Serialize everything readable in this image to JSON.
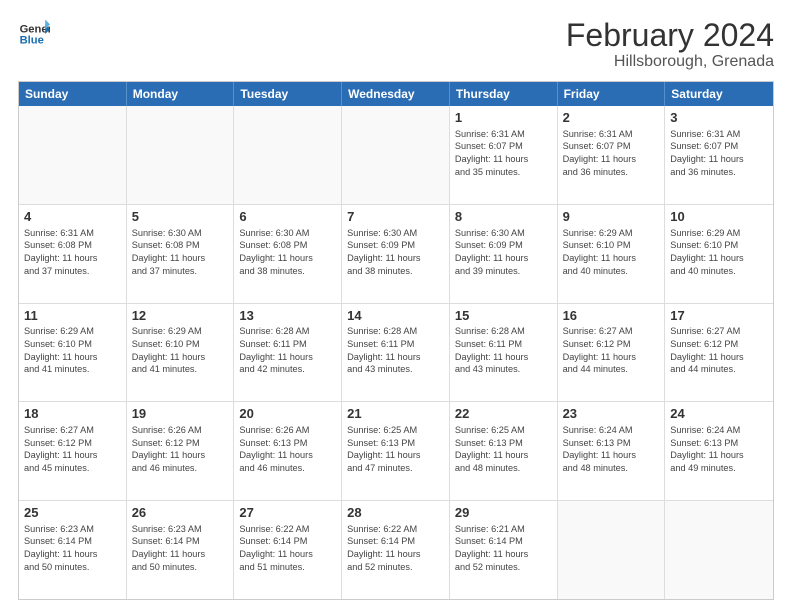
{
  "header": {
    "logo_line1": "General",
    "logo_line2": "Blue",
    "main_title": "February 2024",
    "sub_title": "Hillsborough, Grenada"
  },
  "days_of_week": [
    "Sunday",
    "Monday",
    "Tuesday",
    "Wednesday",
    "Thursday",
    "Friday",
    "Saturday"
  ],
  "weeks": [
    [
      {
        "day": "",
        "info": ""
      },
      {
        "day": "",
        "info": ""
      },
      {
        "day": "",
        "info": ""
      },
      {
        "day": "",
        "info": ""
      },
      {
        "day": "1",
        "info": "Sunrise: 6:31 AM\nSunset: 6:07 PM\nDaylight: 11 hours\nand 35 minutes."
      },
      {
        "day": "2",
        "info": "Sunrise: 6:31 AM\nSunset: 6:07 PM\nDaylight: 11 hours\nand 36 minutes."
      },
      {
        "day": "3",
        "info": "Sunrise: 6:31 AM\nSunset: 6:07 PM\nDaylight: 11 hours\nand 36 minutes."
      }
    ],
    [
      {
        "day": "4",
        "info": "Sunrise: 6:31 AM\nSunset: 6:08 PM\nDaylight: 11 hours\nand 37 minutes."
      },
      {
        "day": "5",
        "info": "Sunrise: 6:30 AM\nSunset: 6:08 PM\nDaylight: 11 hours\nand 37 minutes."
      },
      {
        "day": "6",
        "info": "Sunrise: 6:30 AM\nSunset: 6:08 PM\nDaylight: 11 hours\nand 38 minutes."
      },
      {
        "day": "7",
        "info": "Sunrise: 6:30 AM\nSunset: 6:09 PM\nDaylight: 11 hours\nand 38 minutes."
      },
      {
        "day": "8",
        "info": "Sunrise: 6:30 AM\nSunset: 6:09 PM\nDaylight: 11 hours\nand 39 minutes."
      },
      {
        "day": "9",
        "info": "Sunrise: 6:29 AM\nSunset: 6:10 PM\nDaylight: 11 hours\nand 40 minutes."
      },
      {
        "day": "10",
        "info": "Sunrise: 6:29 AM\nSunset: 6:10 PM\nDaylight: 11 hours\nand 40 minutes."
      }
    ],
    [
      {
        "day": "11",
        "info": "Sunrise: 6:29 AM\nSunset: 6:10 PM\nDaylight: 11 hours\nand 41 minutes."
      },
      {
        "day": "12",
        "info": "Sunrise: 6:29 AM\nSunset: 6:10 PM\nDaylight: 11 hours\nand 41 minutes."
      },
      {
        "day": "13",
        "info": "Sunrise: 6:28 AM\nSunset: 6:11 PM\nDaylight: 11 hours\nand 42 minutes."
      },
      {
        "day": "14",
        "info": "Sunrise: 6:28 AM\nSunset: 6:11 PM\nDaylight: 11 hours\nand 43 minutes."
      },
      {
        "day": "15",
        "info": "Sunrise: 6:28 AM\nSunset: 6:11 PM\nDaylight: 11 hours\nand 43 minutes."
      },
      {
        "day": "16",
        "info": "Sunrise: 6:27 AM\nSunset: 6:12 PM\nDaylight: 11 hours\nand 44 minutes."
      },
      {
        "day": "17",
        "info": "Sunrise: 6:27 AM\nSunset: 6:12 PM\nDaylight: 11 hours\nand 44 minutes."
      }
    ],
    [
      {
        "day": "18",
        "info": "Sunrise: 6:27 AM\nSunset: 6:12 PM\nDaylight: 11 hours\nand 45 minutes."
      },
      {
        "day": "19",
        "info": "Sunrise: 6:26 AM\nSunset: 6:12 PM\nDaylight: 11 hours\nand 46 minutes."
      },
      {
        "day": "20",
        "info": "Sunrise: 6:26 AM\nSunset: 6:13 PM\nDaylight: 11 hours\nand 46 minutes."
      },
      {
        "day": "21",
        "info": "Sunrise: 6:25 AM\nSunset: 6:13 PM\nDaylight: 11 hours\nand 47 minutes."
      },
      {
        "day": "22",
        "info": "Sunrise: 6:25 AM\nSunset: 6:13 PM\nDaylight: 11 hours\nand 48 minutes."
      },
      {
        "day": "23",
        "info": "Sunrise: 6:24 AM\nSunset: 6:13 PM\nDaylight: 11 hours\nand 48 minutes."
      },
      {
        "day": "24",
        "info": "Sunrise: 6:24 AM\nSunset: 6:13 PM\nDaylight: 11 hours\nand 49 minutes."
      }
    ],
    [
      {
        "day": "25",
        "info": "Sunrise: 6:23 AM\nSunset: 6:14 PM\nDaylight: 11 hours\nand 50 minutes."
      },
      {
        "day": "26",
        "info": "Sunrise: 6:23 AM\nSunset: 6:14 PM\nDaylight: 11 hours\nand 50 minutes."
      },
      {
        "day": "27",
        "info": "Sunrise: 6:22 AM\nSunset: 6:14 PM\nDaylight: 11 hours\nand 51 minutes."
      },
      {
        "day": "28",
        "info": "Sunrise: 6:22 AM\nSunset: 6:14 PM\nDaylight: 11 hours\nand 52 minutes."
      },
      {
        "day": "29",
        "info": "Sunrise: 6:21 AM\nSunset: 6:14 PM\nDaylight: 11 hours\nand 52 minutes."
      },
      {
        "day": "",
        "info": ""
      },
      {
        "day": "",
        "info": ""
      }
    ]
  ]
}
